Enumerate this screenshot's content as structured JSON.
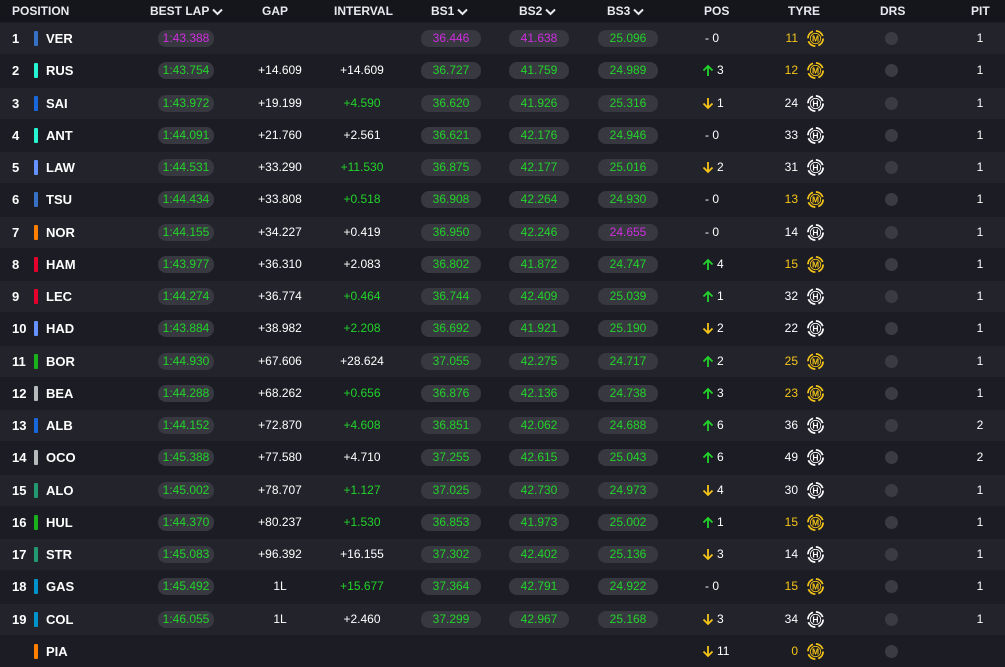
{
  "header": {
    "position": "POSITION",
    "best_lap": "BEST LAP",
    "gap": "GAP",
    "interval": "INTERVAL",
    "bs1": "BS1",
    "bs2": "BS2",
    "bs3": "BS3",
    "pos": "POS",
    "tyre": "TYRE",
    "drs": "DRS",
    "pit": "PIT"
  },
  "colors": {
    "green": "#22d42a",
    "purple": "#d02ee0",
    "yellow": "#f5c518",
    "white": "#ffffff"
  },
  "rows": [
    {
      "position": "1",
      "code": "VER",
      "team_color": "#3671c6",
      "best_lap": "1:43.388",
      "best_lap_color": "purple",
      "gap": "",
      "interval": "",
      "interval_color": "white",
      "bs1": "36.446",
      "bs1_color": "purple",
      "bs2": "41.638",
      "bs2_color": "purple",
      "bs3": "25.096",
      "bs3_color": "green",
      "pos_dir": "none",
      "pos_change": "- 0",
      "tyre_laps": "11",
      "tyre_color": "yellow",
      "tyre_compound": "M",
      "tyre_icon": "medium-tyre-icon",
      "pit": "1"
    },
    {
      "position": "2",
      "code": "RUS",
      "team_color": "#27f4d2",
      "best_lap": "1:43.754",
      "best_lap_color": "green",
      "gap": "+14.609",
      "interval": "+14.609",
      "interval_color": "white",
      "bs1": "36.727",
      "bs1_color": "green",
      "bs2": "41.759",
      "bs2_color": "green",
      "bs3": "24.989",
      "bs3_color": "green",
      "pos_dir": "up",
      "pos_change": "3",
      "tyre_laps": "12",
      "tyre_color": "yellow",
      "tyre_compound": "M",
      "tyre_icon": "medium-tyre-icon",
      "pit": "1"
    },
    {
      "position": "3",
      "code": "SAI",
      "team_color": "#1868db",
      "best_lap": "1:43.972",
      "best_lap_color": "green",
      "gap": "+19.199",
      "interval": "+4.590",
      "interval_color": "green",
      "bs1": "36.620",
      "bs1_color": "green",
      "bs2": "41.926",
      "bs2_color": "green",
      "bs3": "25.316",
      "bs3_color": "green",
      "pos_dir": "down",
      "pos_change": "1",
      "tyre_laps": "24",
      "tyre_color": "white",
      "tyre_compound": "H",
      "tyre_icon": "hard-tyre-icon",
      "pit": "1"
    },
    {
      "position": "4",
      "code": "ANT",
      "team_color": "#27f4d2",
      "best_lap": "1:44.091",
      "best_lap_color": "green",
      "gap": "+21.760",
      "interval": "+2.561",
      "interval_color": "white",
      "bs1": "36.621",
      "bs1_color": "green",
      "bs2": "42.176",
      "bs2_color": "green",
      "bs3": "24.946",
      "bs3_color": "green",
      "pos_dir": "none",
      "pos_change": "- 0",
      "tyre_laps": "33",
      "tyre_color": "white",
      "tyre_compound": "H",
      "tyre_icon": "hard-tyre-icon",
      "pit": "1"
    },
    {
      "position": "5",
      "code": "LAW",
      "team_color": "#6692ff",
      "best_lap": "1:44.531",
      "best_lap_color": "green",
      "gap": "+33.290",
      "interval": "+11.530",
      "interval_color": "green",
      "bs1": "36.875",
      "bs1_color": "green",
      "bs2": "42.177",
      "bs2_color": "green",
      "bs3": "25.016",
      "bs3_color": "green",
      "pos_dir": "down",
      "pos_change": "2",
      "tyre_laps": "31",
      "tyre_color": "white",
      "tyre_compound": "H",
      "tyre_icon": "hard-tyre-icon",
      "pit": "1"
    },
    {
      "position": "6",
      "code": "TSU",
      "team_color": "#3671c6",
      "best_lap": "1:44.434",
      "best_lap_color": "green",
      "gap": "+33.808",
      "interval": "+0.518",
      "interval_color": "green",
      "bs1": "36.908",
      "bs1_color": "green",
      "bs2": "42.264",
      "bs2_color": "green",
      "bs3": "24.930",
      "bs3_color": "green",
      "pos_dir": "none",
      "pos_change": "- 0",
      "tyre_laps": "13",
      "tyre_color": "yellow",
      "tyre_compound": "M",
      "tyre_icon": "medium-tyre-icon",
      "pit": "1"
    },
    {
      "position": "7",
      "code": "NOR",
      "team_color": "#ff8000",
      "best_lap": "1:44.155",
      "best_lap_color": "green",
      "gap": "+34.227",
      "interval": "+0.419",
      "interval_color": "white",
      "bs1": "36.950",
      "bs1_color": "green",
      "bs2": "42.246",
      "bs2_color": "green",
      "bs3": "24.655",
      "bs3_color": "purple",
      "pos_dir": "none",
      "pos_change": "- 0",
      "tyre_laps": "14",
      "tyre_color": "white",
      "tyre_compound": "H",
      "tyre_icon": "hard-tyre-icon",
      "pit": "1"
    },
    {
      "position": "8",
      "code": "HAM",
      "team_color": "#e8002d",
      "best_lap": "1:43.977",
      "best_lap_color": "green",
      "gap": "+36.310",
      "interval": "+2.083",
      "interval_color": "white",
      "bs1": "36.802",
      "bs1_color": "green",
      "bs2": "41.872",
      "bs2_color": "green",
      "bs3": "24.747",
      "bs3_color": "green",
      "pos_dir": "up",
      "pos_change": "4",
      "tyre_laps": "15",
      "tyre_color": "yellow",
      "tyre_compound": "M",
      "tyre_icon": "medium-tyre-icon",
      "pit": "1"
    },
    {
      "position": "9",
      "code": "LEC",
      "team_color": "#e8002d",
      "best_lap": "1:44.274",
      "best_lap_color": "green",
      "gap": "+36.774",
      "interval": "+0.464",
      "interval_color": "green",
      "bs1": "36.744",
      "bs1_color": "green",
      "bs2": "42.409",
      "bs2_color": "green",
      "bs3": "25.039",
      "bs3_color": "green",
      "pos_dir": "up",
      "pos_change": "1",
      "tyre_laps": "32",
      "tyre_color": "white",
      "tyre_compound": "H",
      "tyre_icon": "hard-tyre-icon",
      "pit": "1"
    },
    {
      "position": "10",
      "code": "HAD",
      "team_color": "#6692ff",
      "best_lap": "1:43.884",
      "best_lap_color": "green",
      "gap": "+38.982",
      "interval": "+2.208",
      "interval_color": "green",
      "bs1": "36.692",
      "bs1_color": "green",
      "bs2": "41.921",
      "bs2_color": "green",
      "bs3": "25.190",
      "bs3_color": "green",
      "pos_dir": "down",
      "pos_change": "2",
      "tyre_laps": "22",
      "tyre_color": "white",
      "tyre_compound": "H",
      "tyre_icon": "hard-tyre-icon",
      "pit": "1"
    },
    {
      "position": "11",
      "code": "BOR",
      "team_color": "#1ab21a",
      "best_lap": "1:44.930",
      "best_lap_color": "green",
      "gap": "+67.606",
      "interval": "+28.624",
      "interval_color": "white",
      "bs1": "37.055",
      "bs1_color": "green",
      "bs2": "42.275",
      "bs2_color": "green",
      "bs3": "24.717",
      "bs3_color": "green",
      "pos_dir": "up",
      "pos_change": "2",
      "tyre_laps": "25",
      "tyre_color": "yellow",
      "tyre_compound": "M",
      "tyre_icon": "medium-tyre-icon",
      "pit": "1"
    },
    {
      "position": "12",
      "code": "BEA",
      "team_color": "#b6babd",
      "best_lap": "1:44.288",
      "best_lap_color": "green",
      "gap": "+68.262",
      "interval": "+0.656",
      "interval_color": "green",
      "bs1": "36.876",
      "bs1_color": "green",
      "bs2": "42.136",
      "bs2_color": "green",
      "bs3": "24.738",
      "bs3_color": "green",
      "pos_dir": "up",
      "pos_change": "3",
      "tyre_laps": "23",
      "tyre_color": "yellow",
      "tyre_compound": "M",
      "tyre_icon": "medium-tyre-icon",
      "pit": "1"
    },
    {
      "position": "13",
      "code": "ALB",
      "team_color": "#1868db",
      "best_lap": "1:44.152",
      "best_lap_color": "green",
      "gap": "+72.870",
      "interval": "+4.608",
      "interval_color": "green",
      "bs1": "36.851",
      "bs1_color": "green",
      "bs2": "42.062",
      "bs2_color": "green",
      "bs3": "24.688",
      "bs3_color": "green",
      "pos_dir": "up",
      "pos_change": "6",
      "tyre_laps": "36",
      "tyre_color": "white",
      "tyre_compound": "H",
      "tyre_icon": "hard-tyre-icon",
      "pit": "2"
    },
    {
      "position": "14",
      "code": "OCO",
      "team_color": "#b6babd",
      "best_lap": "1:45.388",
      "best_lap_color": "green",
      "gap": "+77.580",
      "interval": "+4.710",
      "interval_color": "white",
      "bs1": "37.255",
      "bs1_color": "green",
      "bs2": "42.615",
      "bs2_color": "green",
      "bs3": "25.043",
      "bs3_color": "green",
      "pos_dir": "up",
      "pos_change": "6",
      "tyre_laps": "49",
      "tyre_color": "white",
      "tyre_compound": "H",
      "tyre_icon": "hard-tyre-icon",
      "pit": "2"
    },
    {
      "position": "15",
      "code": "ALO",
      "team_color": "#229971",
      "best_lap": "1:45.002",
      "best_lap_color": "green",
      "gap": "+78.707",
      "interval": "+1.127",
      "interval_color": "green",
      "bs1": "37.025",
      "bs1_color": "green",
      "bs2": "42.730",
      "bs2_color": "green",
      "bs3": "24.973",
      "bs3_color": "green",
      "pos_dir": "down",
      "pos_change": "4",
      "tyre_laps": "30",
      "tyre_color": "white",
      "tyre_compound": "H",
      "tyre_icon": "hard-tyre-icon",
      "pit": "1"
    },
    {
      "position": "16",
      "code": "HUL",
      "team_color": "#1ab21a",
      "best_lap": "1:44.370",
      "best_lap_color": "green",
      "gap": "+80.237",
      "interval": "+1.530",
      "interval_color": "green",
      "bs1": "36.853",
      "bs1_color": "green",
      "bs2": "41.973",
      "bs2_color": "green",
      "bs3": "25.002",
      "bs3_color": "green",
      "pos_dir": "up",
      "pos_change": "1",
      "tyre_laps": "15",
      "tyre_color": "yellow",
      "tyre_compound": "M",
      "tyre_icon": "medium-tyre-icon",
      "pit": "1"
    },
    {
      "position": "17",
      "code": "STR",
      "team_color": "#229971",
      "best_lap": "1:45.083",
      "best_lap_color": "green",
      "gap": "+96.392",
      "interval": "+16.155",
      "interval_color": "white",
      "bs1": "37.302",
      "bs1_color": "green",
      "bs2": "42.402",
      "bs2_color": "green",
      "bs3": "25.136",
      "bs3_color": "green",
      "pos_dir": "down",
      "pos_change": "3",
      "tyre_laps": "14",
      "tyre_color": "white",
      "tyre_compound": "H",
      "tyre_icon": "hard-tyre-icon",
      "pit": "1"
    },
    {
      "position": "18",
      "code": "GAS",
      "team_color": "#0093cc",
      "best_lap": "1:45.492",
      "best_lap_color": "green",
      "gap": "1L",
      "interval": "+15.677",
      "interval_color": "green",
      "bs1": "37.364",
      "bs1_color": "green",
      "bs2": "42.791",
      "bs2_color": "green",
      "bs3": "24.922",
      "bs3_color": "green",
      "pos_dir": "none",
      "pos_change": "- 0",
      "tyre_laps": "15",
      "tyre_color": "yellow",
      "tyre_compound": "M",
      "tyre_icon": "medium-tyre-icon",
      "pit": "1"
    },
    {
      "position": "19",
      "code": "COL",
      "team_color": "#0093cc",
      "best_lap": "1:46.055",
      "best_lap_color": "green",
      "gap": "1L",
      "interval": "+2.460",
      "interval_color": "white",
      "bs1": "37.299",
      "bs1_color": "green",
      "bs2": "42.967",
      "bs2_color": "green",
      "bs3": "25.168",
      "bs3_color": "green",
      "pos_dir": "down",
      "pos_change": "3",
      "tyre_laps": "34",
      "tyre_color": "white",
      "tyre_compound": "H",
      "tyre_icon": "hard-tyre-icon",
      "pit": "1"
    },
    {
      "position": "",
      "code": "PIA",
      "team_color": "#ff8000",
      "best_lap": "",
      "best_lap_color": "green",
      "gap": "",
      "interval": "",
      "interval_color": "white",
      "bs1": "",
      "bs1_color": "green",
      "bs2": "",
      "bs2_color": "green",
      "bs3": "",
      "bs3_color": "green",
      "pos_dir": "down",
      "pos_change": "11",
      "tyre_laps": "0",
      "tyre_color": "yellow",
      "tyre_compound": "M",
      "tyre_icon": "medium-tyre-icon",
      "pit": ""
    }
  ]
}
